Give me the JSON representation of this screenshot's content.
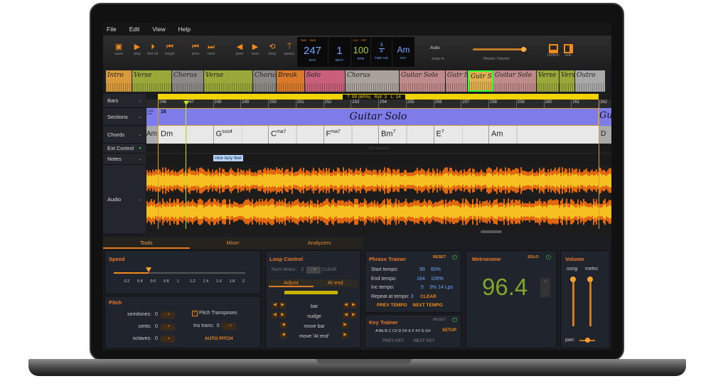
{
  "menu": [
    "File",
    "Edit",
    "View",
    "Help"
  ],
  "toolbar": {
    "buttons": [
      {
        "icon": "save-icon",
        "glyph": "▣",
        "label": "save"
      },
      {
        "icon": "play-icon",
        "glyph": "▶",
        "label": "play"
      },
      {
        "icon": "play-from-last-icon",
        "glyph": "⏵",
        "label": "frm lst"
      },
      {
        "icon": "rewind-begin-icon",
        "glyph": "⏮",
        "label": "begin"
      },
      {
        "icon": "prev-bar-icon",
        "glyph": "⏮",
        "label": "prev"
      },
      {
        "icon": "next-bar-icon",
        "glyph": "⏭",
        "label": "next"
      },
      {
        "icon": "prev-section-icon",
        "glyph": "◀",
        "label": "prev"
      },
      {
        "icon": "next-section-icon",
        "glyph": "▶",
        "label": "next"
      },
      {
        "icon": "loop-icon",
        "glyph": "⟲",
        "label": "loop"
      },
      {
        "icon": "space-icon",
        "glyph": "⍡",
        "label": "space"
      }
    ],
    "lcd": {
      "tag_time": "TIME",
      "tag_bar": "BAR",
      "bar": "247",
      "bar_label": "BAR",
      "beat": "1",
      "beat_label": "BEAT",
      "tag_clk": "CLK",
      "tag_pbt": "PBT",
      "bpm": "100",
      "bpm_label": "BPM",
      "time_sig_top": "3",
      "time_sig_bottom": "4",
      "time_sig_label": "TIME SIG",
      "key": "Am",
      "key_label": "KEY"
    },
    "snap_value": "Auto",
    "snap_label": "snap to",
    "master_volume_label": "Master Volume",
    "master_volume": 0.95,
    "bottom_label": "bottom",
    "side_label": "side"
  },
  "sections_overview": [
    {
      "label": "Intro",
      "color": "#d89a3a"
    },
    {
      "label": "Verse",
      "color": "#9aa83a"
    },
    {
      "label": "Chorus",
      "color": "#8c8a86"
    },
    {
      "label": "Verse",
      "color": "#9aa83a"
    },
    {
      "label": "Chorus",
      "color": "#8c8a86"
    },
    {
      "label": "Break",
      "color": "#d87a2a"
    },
    {
      "label": "Solo",
      "color": "#c8607a"
    },
    {
      "label": "Chorus",
      "color": "#a8a29a"
    },
    {
      "label": "Guitar Solo",
      "color": "#c08a8a"
    },
    {
      "label": "Gutr Sol",
      "color": "#c08a8a"
    },
    {
      "label": "Gutr Solo",
      "color": "#e0b050"
    },
    {
      "label": "Guitar Solo",
      "color": "#c08a8a"
    },
    {
      "label": "Verse",
      "color": "#9aa83a"
    },
    {
      "label": "Verse",
      "color": "#9aa83a"
    },
    {
      "label": "Outro",
      "color": "#a8a8a8"
    }
  ],
  "tracks": {
    "bars": "Bars",
    "sections": "Sections",
    "chords": "Chords",
    "ext_control": "Ext Control",
    "notes": "Notes",
    "audio": "Audio"
  },
  "loop_info": "T: 99 (60%)   Rpt: 3   L: 14",
  "bar_numbers": [
    "246",
    "247",
    "248",
    "249",
    "250",
    "251",
    "252",
    "253",
    "254",
    "255",
    "256",
    "257",
    "258",
    "259",
    "260",
    "261",
    "262"
  ],
  "section_lane": {
    "number": "16",
    "title": "Guitar Solo",
    "next": "Gu",
    "prev_label": "Guitar Solo"
  },
  "chords": [
    {
      "root": "Dm",
      "ext": ""
    },
    {
      "root": "G",
      "ext": "sus4"
    },
    {
      "root": "C",
      "ext": "ma7"
    },
    {
      "root": "F",
      "ext": "ma7"
    },
    {
      "root": "Bm",
      "ext": "7"
    },
    {
      "root": "E",
      "ext": "7"
    },
    {
      "root": "Am",
      "ext": ""
    }
  ],
  "chord_prev": "Am",
  "chord_next": "D",
  "ext_control_empty": "No markers",
  "note_text": "nice lazy feel",
  "tabs": [
    "Tools",
    "Mixer",
    "Analyzers"
  ],
  "speed": {
    "title": "Speed",
    "ticks": [
      "0.2",
      "0.4",
      "0.6",
      "0.8",
      "1",
      "1.2",
      "1.4",
      "1.6",
      "1.8",
      "2"
    ],
    "value": 0.6
  },
  "pitch": {
    "title": "Pitch",
    "semitones_label": "semitones:",
    "semitones": "0",
    "cents_label": "cents:",
    "cents": "0",
    "octaves_label": "octaves:",
    "octaves": "0",
    "pitch_transposes": "Pitch Transposes",
    "ins_trans_label": "Ins trans:",
    "ins_trans": "0",
    "auto_pitch": "AUTO PITCH",
    "minus": "-",
    "plus": "+"
  },
  "loop_control": {
    "title": "Loop Control",
    "num_times_label": "Num times:",
    "num_times": "2",
    "clear": "CLEAR",
    "tab_adjust": "Adjust",
    "tab_at_end": "At end",
    "bar": "bar",
    "nudge": "nudge",
    "move_bar": "move bar",
    "move_at_end": "move 'At end'"
  },
  "phrase_trainer": {
    "title": "Phrase Trainer",
    "reset": "RESET",
    "start_label": "Start tempo:",
    "start": "99",
    "start_pct": "60%",
    "end_label": "End tempo:",
    "end": "164",
    "end_pct": "100%",
    "inc_label": "Inc tempo:",
    "inc": "5",
    "inc_pct": "3%",
    "inc_lps": "14 Lps",
    "repeat_label": "Repeat at tempo:",
    "repeat": "3",
    "clear": "CLEAR",
    "prev": "PREV TEMPO",
    "next": "NEXT TEMPO"
  },
  "key_trainer": {
    "title": "Key Trainer",
    "reset": "RESET",
    "keys": "A Bb B C C# D D# E F F# G G#",
    "setup": "SETUP",
    "prev": "PREV KEY",
    "next": "NEXT KEY"
  },
  "metronome": {
    "title": "Metronome",
    "solo": "SOLO",
    "value": "96.4",
    "plus": "+",
    "minus": "-"
  },
  "volume": {
    "title": "Volume",
    "song": "song",
    "metro": "metro",
    "pan": "pan:",
    "song_level": 0.95,
    "metro_level": 0.95,
    "pan_value": 0.5
  },
  "colors": {
    "accent": "#f08a1c",
    "lcd_blue": "#6fa8ff",
    "bpm_green": "#a6d23a",
    "section_purple": "#7e7ce8",
    "loop_yellow": "#f2d400",
    "metronome_green": "#7fa82a"
  }
}
